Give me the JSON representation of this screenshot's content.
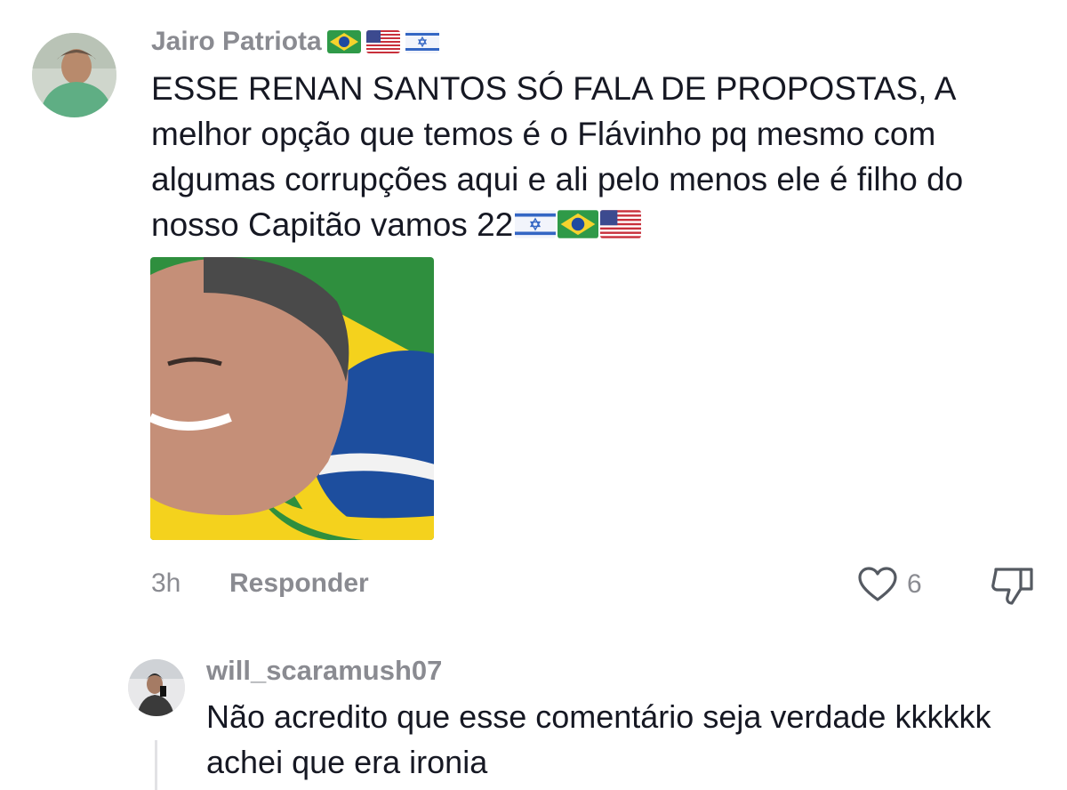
{
  "comments": [
    {
      "username": "Jairo Patriota",
      "username_flags": [
        "brazil-flag",
        "usa-flag",
        "israel-flag"
      ],
      "text": "ESSE RENAN SANTOS SÓ FALA DE PROPOSTAS, A melhor opção que temos é o Flávinho pq mesmo com algumas corrupções aqui e ali pelo menos ele é filho do nosso Capitão vamos 22",
      "text_flags": [
        "israel-flag",
        "brazil-flag",
        "usa-flag"
      ],
      "image": "photo-man-laughing-brazil-flag",
      "time": "3h",
      "reply_label": "Responder",
      "likes": "6",
      "icons": {
        "like": "heart-icon",
        "dislike": "thumbs-down-icon"
      }
    },
    {
      "username": "will_scaramush07",
      "text": "Não acredito que esse comentário seja verdade kkkkkk achei que era ironia"
    }
  ],
  "colors": {
    "text": "#161823",
    "muted": "#8a8b91",
    "background": "#ffffff"
  }
}
